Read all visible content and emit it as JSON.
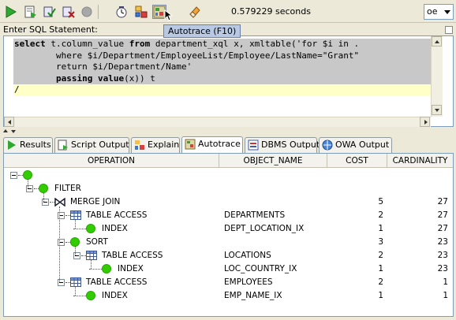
{
  "toolbar": {
    "timing": "0.579229 seconds",
    "connection": "oe",
    "tooltip": "Autotrace (F10)"
  },
  "editor": {
    "label": "Enter SQL Statement:",
    "lines": [
      "select t.column_value from department_xql x, xmltable('for $i in .",
      "        where $i/Department/EmployeeList/Employee/LastName=\"Grant\"",
      "        return $i/Department/Name'",
      "        passing value(x)) t",
      "/"
    ]
  },
  "tabs": [
    {
      "label": "Results",
      "icon": "run-icon"
    },
    {
      "label": "Script Output",
      "icon": "script-icon"
    },
    {
      "label": "Explain",
      "icon": "explain-icon"
    },
    {
      "label": "Autotrace",
      "icon": "autotrace-icon",
      "active": true
    },
    {
      "label": "DBMS Output",
      "icon": "dbms-icon"
    },
    {
      "label": "OWA Output",
      "icon": "owa-icon"
    }
  ],
  "grid": {
    "columns": [
      "OPERATION",
      "OBJECT_NAME",
      "COST",
      "CARDINALITY"
    ],
    "rows": [
      {
        "operation": "",
        "icon": "green-dot-icon",
        "object_name": "",
        "cost": "",
        "cardinality": ""
      },
      {
        "operation": "FILTER",
        "icon": "green-dot-icon",
        "object_name": "",
        "cost": "",
        "cardinality": ""
      },
      {
        "operation": "MERGE JOIN",
        "icon": "merge-join-icon",
        "object_name": "",
        "cost": "5",
        "cardinality": "27"
      },
      {
        "operation": "TABLE ACCESS",
        "icon": "table-icon",
        "object_name": "DEPARTMENTS",
        "cost": "2",
        "cardinality": "27"
      },
      {
        "operation": "INDEX",
        "icon": "green-dot-icon",
        "object_name": "DEPT_LOCATION_IX",
        "cost": "1",
        "cardinality": "27"
      },
      {
        "operation": "SORT",
        "icon": "green-dot-icon",
        "object_name": "",
        "cost": "3",
        "cardinality": "23"
      },
      {
        "operation": "TABLE ACCESS",
        "icon": "table-icon",
        "object_name": "LOCATIONS",
        "cost": "2",
        "cardinality": "23"
      },
      {
        "operation": "INDEX",
        "icon": "green-dot-icon",
        "object_name": "LOC_COUNTRY_IX",
        "cost": "1",
        "cardinality": "23"
      },
      {
        "operation": "TABLE ACCESS",
        "icon": "table-icon",
        "object_name": "EMPLOYEES",
        "cost": "2",
        "cardinality": "1"
      },
      {
        "operation": "INDEX",
        "icon": "green-dot-icon",
        "object_name": "EMP_NAME_IX",
        "cost": "1",
        "cardinality": "1"
      }
    ]
  }
}
